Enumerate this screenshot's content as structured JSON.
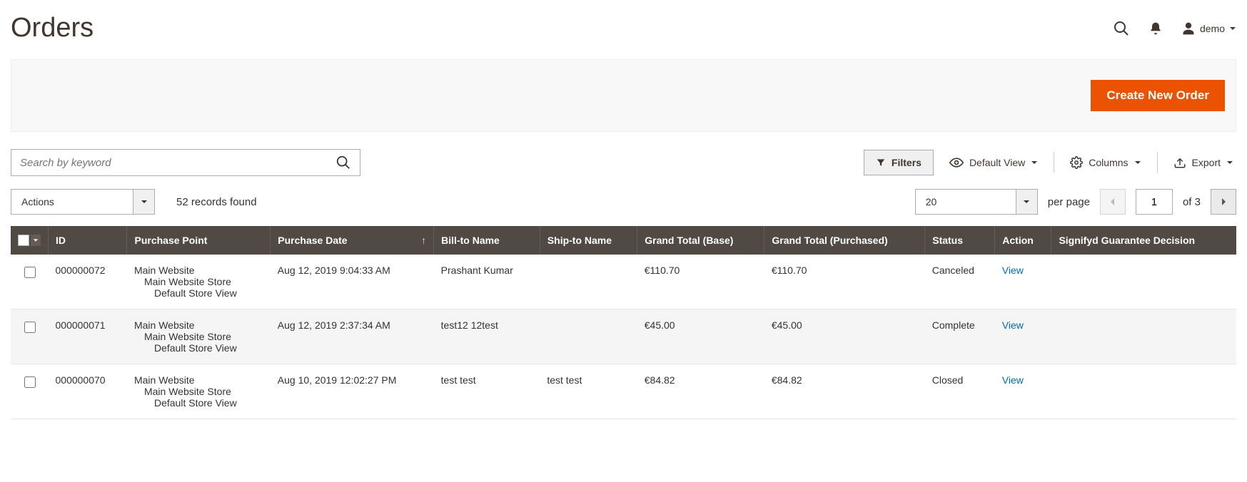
{
  "header": {
    "title": "Orders",
    "user_label": "demo"
  },
  "actionBar": {
    "create_btn": "Create New Order"
  },
  "toolbar": {
    "search_placeholder": "Search by keyword",
    "filters_btn": "Filters",
    "default_view": "Default View",
    "columns": "Columns",
    "export": "Export"
  },
  "gridControls": {
    "actions_label": "Actions",
    "records_found": "52 records found",
    "page_size": "20",
    "per_page": "per page",
    "current_page": "1",
    "of_pages": "of 3"
  },
  "table": {
    "headers": {
      "id": "ID",
      "purchase_point": "Purchase Point",
      "purchase_date": "Purchase Date",
      "bill_to": "Bill-to Name",
      "ship_to": "Ship-to Name",
      "grand_base": "Grand Total (Base)",
      "grand_purchased": "Grand Total (Purchased)",
      "status": "Status",
      "action": "Action",
      "signifyd": "Signifyd Guarantee Decision"
    },
    "rows": [
      {
        "id": "000000072",
        "pp1": "Main Website",
        "pp2": "Main Website Store",
        "pp3": "Default Store View",
        "date": "Aug 12, 2019 9:04:33 AM",
        "bill_to": "Prashant Kumar",
        "ship_to": "",
        "grand_base": "€110.70",
        "grand_purchased": "€110.70",
        "status": "Canceled",
        "action": "View",
        "signifyd": ""
      },
      {
        "id": "000000071",
        "pp1": "Main Website",
        "pp2": "Main Website Store",
        "pp3": "Default Store View",
        "date": "Aug 12, 2019 2:37:34 AM",
        "bill_to": "test12 12test",
        "ship_to": "",
        "grand_base": "€45.00",
        "grand_purchased": "€45.00",
        "status": "Complete",
        "action": "View",
        "signifyd": ""
      },
      {
        "id": "000000070",
        "pp1": "Main Website",
        "pp2": "Main Website Store",
        "pp3": "Default Store View",
        "date": "Aug 10, 2019 12:02:27 PM",
        "bill_to": "test test",
        "ship_to": "test test",
        "grand_base": "€84.82",
        "grand_purchased": "€84.82",
        "status": "Closed",
        "action": "View",
        "signifyd": ""
      }
    ]
  }
}
